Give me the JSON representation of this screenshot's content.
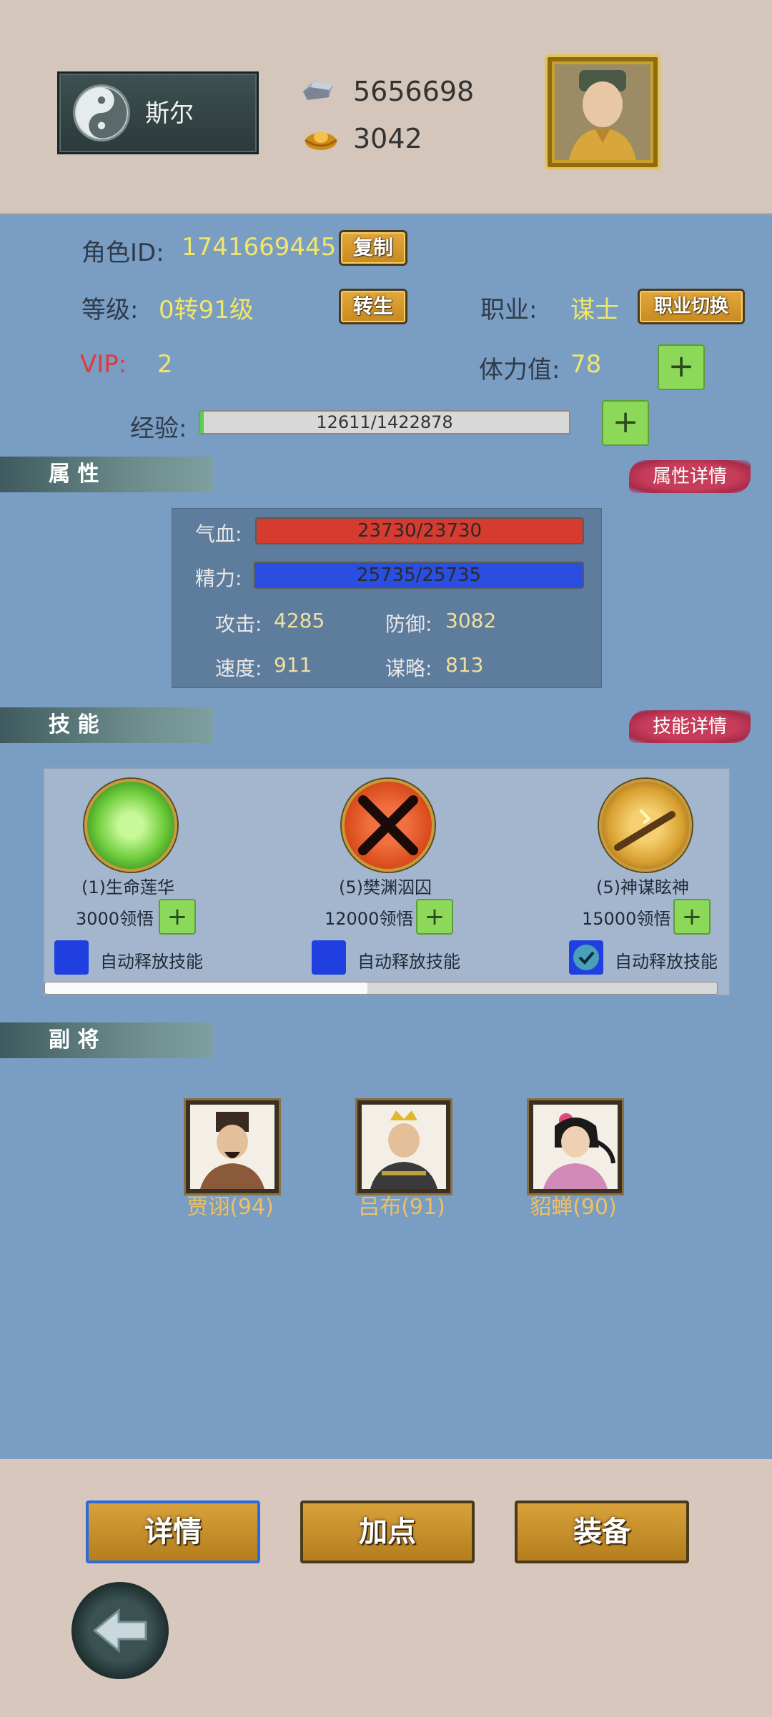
{
  "header": {
    "player_name": "斯尔",
    "silver": "5656698",
    "gold": "3042"
  },
  "profile": {
    "id_label": "角色ID:",
    "id_value": "1741669445",
    "copy_btn": "复制",
    "level_label": "等级:",
    "level_value": "0转91级",
    "rebirth_btn": "转生",
    "job_label": "职业:",
    "job_value": "谋士",
    "job_switch_btn": "职业切换",
    "vip_label": "VIP:",
    "vip_value": "2",
    "stamina_label": "体力值:",
    "stamina_value": "78",
    "exp_label": "经验:",
    "exp_text": "12611/1422878",
    "exp_fraction": 0.0089
  },
  "attributes": {
    "section_title": "属 性",
    "detail_btn": "属性详情",
    "hp_label": "气血:",
    "hp_text": "23730/23730",
    "mp_label": "精力:",
    "mp_text": "25735/25735",
    "atk_label": "攻击:",
    "atk_value": "4285",
    "def_label": "防御:",
    "def_value": "3082",
    "spd_label": "速度:",
    "spd_value": "911",
    "str_label": "谋略:",
    "str_value": "813"
  },
  "skills": {
    "section_title": "技 能",
    "detail_btn": "技能详情",
    "auto_label": "自动释放技能",
    "items": [
      {
        "name": "(1)生命莲华",
        "cost": "3000领悟",
        "auto": false
      },
      {
        "name": "(5)樊渊泅囚",
        "cost": "12000领悟",
        "auto": false
      },
      {
        "name": "(5)神谋眩神",
        "cost": "15000领悟",
        "auto": true
      }
    ],
    "scroll_fraction": 0.48
  },
  "generals": {
    "section_title": "副 将",
    "items": [
      {
        "name": "贾诩(94)"
      },
      {
        "name": "吕布(91)"
      },
      {
        "name": "貂蝉(90)"
      }
    ]
  },
  "footer": {
    "tab_detail": "详情",
    "tab_points": "加点",
    "tab_equip": "装备"
  },
  "colors": {
    "panel_blue": "#7a9dc3",
    "hp_red": "#d63b30",
    "mp_blue": "#2a4fe0",
    "accent_yellow": "#f0e66a",
    "vip_red": "#e03a3a"
  },
  "icons": [
    "taiji-icon",
    "silver-ingot-icon",
    "gold-ingot-icon",
    "plus-icon",
    "check-icon",
    "back-arrow-icon"
  ]
}
